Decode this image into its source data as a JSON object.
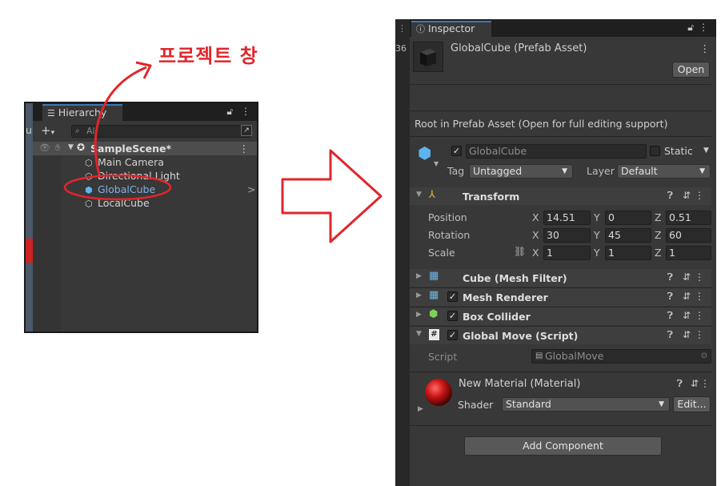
{
  "annotation": {
    "title": "프로젝트 창"
  },
  "hierarchy": {
    "tab_label": "Hierarchy",
    "search_placeholder": "All",
    "scene_name": "SampleScene*",
    "items": [
      "Main Camera",
      "Directional Light",
      "GlobalCube",
      "LocalCube"
    ],
    "partial_left_char": "u",
    "more_glyph": ">"
  },
  "inspector": {
    "tab_label": "Inspector",
    "side_number": "36",
    "asset_title": "GlobalCube (Prefab Asset)",
    "open_button": "Open",
    "prefab_notice": "Root in Prefab Asset (Open for full editing support)",
    "object_name": "GlobalCube",
    "static_label": "Static",
    "tag_label": "Tag",
    "tag_value": "Untagged",
    "layer_label": "Layer",
    "layer_value": "Default",
    "transform": {
      "title": "Transform",
      "position_label": "Position",
      "rotation_label": "Rotation",
      "scale_label": "Scale",
      "axis_x": "X",
      "axis_y": "Y",
      "axis_z": "Z",
      "position": [
        "14.51",
        "0",
        "0.51"
      ],
      "rotation": [
        "30",
        "45",
        "60"
      ],
      "scale": [
        "1",
        "1",
        "1"
      ]
    },
    "components": [
      "Cube (Mesh Filter)",
      "Mesh Renderer",
      "Box Collider",
      "Global Move (Script)"
    ],
    "script_label": "Script",
    "script_value": "GlobalMove",
    "material": {
      "title": "New Material (Material)",
      "shader_label": "Shader",
      "shader_value": "Standard",
      "edit_button": "Edit..."
    },
    "add_component_button": "Add Component"
  },
  "colors": {
    "annotation_red": "#e0262b",
    "selected_blue": "#7fb2e6",
    "unity_panel": "#383838"
  }
}
